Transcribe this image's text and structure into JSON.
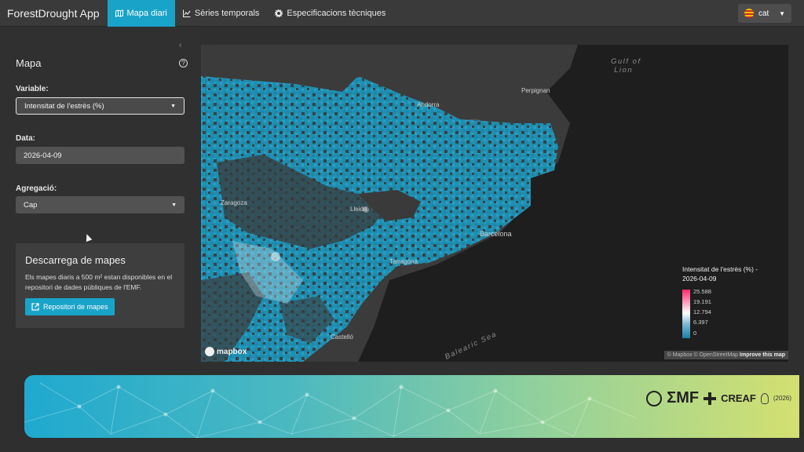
{
  "navbar": {
    "brand": "ForestDrought App",
    "tabs": [
      {
        "label": "Mapa diari",
        "icon": "map-icon",
        "active": true
      },
      {
        "label": "Sèries temporals",
        "icon": "line-chart-icon",
        "active": false
      },
      {
        "label": "Especificacions tècniques",
        "icon": "gear-icon",
        "active": false
      }
    ],
    "language": {
      "label": "cat",
      "icon": "catalan-flag-icon"
    }
  },
  "sidebar": {
    "title": "Mapa",
    "help_icon": "question-circle-icon",
    "variable": {
      "label": "Variable:",
      "value": "Intensitat de l'estrès (%)"
    },
    "date": {
      "label": "Data:",
      "value": "2026-04-09"
    },
    "aggregation": {
      "label": "Agregació:",
      "value": "Cap"
    },
    "download": {
      "title": "Descarrega de mapes",
      "text": "Els mapes diaris a 500 m² estan disponibles en el repositori de dades públiques de l'EMF.",
      "button_label": "Repositori de mapes",
      "button_icon": "external-link-icon"
    }
  },
  "map": {
    "places": [
      "Perpignan",
      "Andorra",
      "Zaragoza",
      "Lleida",
      "Barcelona",
      "Tarragona",
      "Castelló"
    ],
    "seas": [
      "Gulf of Lion",
      "Balearic Sea"
    ],
    "legend": {
      "title": "Intensitat de l'estrès (%) -",
      "date": "2026-04-09",
      "ticks": [
        "25.588",
        "19.191",
        "12.794",
        "6.397",
        "0"
      ],
      "colors": {
        "high": "#ff2a6d",
        "mid": "#ffffff",
        "low": "#1a7fa6"
      }
    },
    "attribution": {
      "prefix": "© Mapbox © OpenStreetMap",
      "link": "Improve this map"
    },
    "logo": "mapbox"
  },
  "footer": {
    "logos": {
      "emf": "ΣMF",
      "creaf": "CREAF",
      "year": "(2026)"
    }
  }
}
